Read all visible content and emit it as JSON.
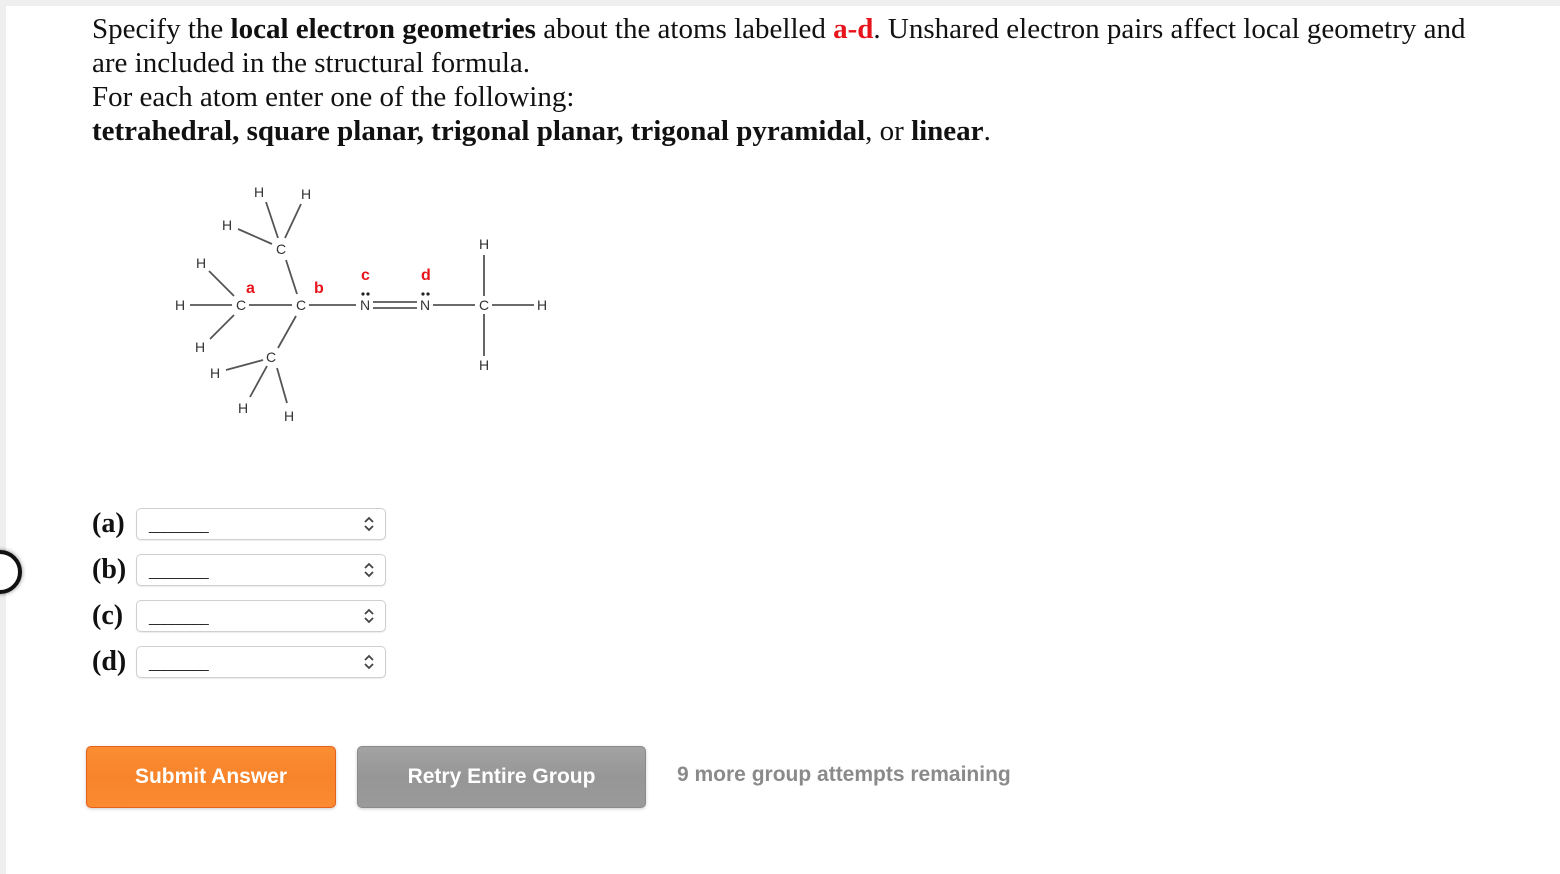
{
  "question": {
    "line1_pre": "Specify the ",
    "line1_bold": "local electron geometries",
    "line1_mid": " about the atoms labelled ",
    "line1_red": "a-d",
    "line1_post": ". Unshared electron pairs affect local geometry and",
    "line2": "are included in the structural formula.",
    "line3": "For each atom enter one of the following:",
    "options": {
      "opt1": "tetrahedral",
      "sep1": ", ",
      "opt2": "square planar",
      "sep2": ", ",
      "opt3": "trigonal planar",
      "sep3": ", ",
      "opt4": "trigonal pyramidal",
      "sep4": ", or ",
      "opt5": "linear",
      "end": "."
    }
  },
  "molecule": {
    "atoms": {
      "H": "H",
      "C": "C",
      "N": "N"
    },
    "labels": {
      "a": "a",
      "b": "b",
      "c": "c",
      "d": "d"
    },
    "lone_pair": "••"
  },
  "answers": [
    {
      "label": "(a)",
      "selected": "________"
    },
    {
      "label": "(b)",
      "selected": "________"
    },
    {
      "label": "(c)",
      "selected": "________"
    },
    {
      "label": "(d)",
      "selected": "________"
    }
  ],
  "buttons": {
    "submit": "Submit Answer",
    "retry": "Retry Entire Group"
  },
  "status": {
    "attempts": "9 more group attempts remaining"
  },
  "colors": {
    "highlight_red": "#e8141b",
    "submit_orange": "#f7842a",
    "retry_gray": "#969696",
    "attempts_text": "#8a8a8a"
  }
}
